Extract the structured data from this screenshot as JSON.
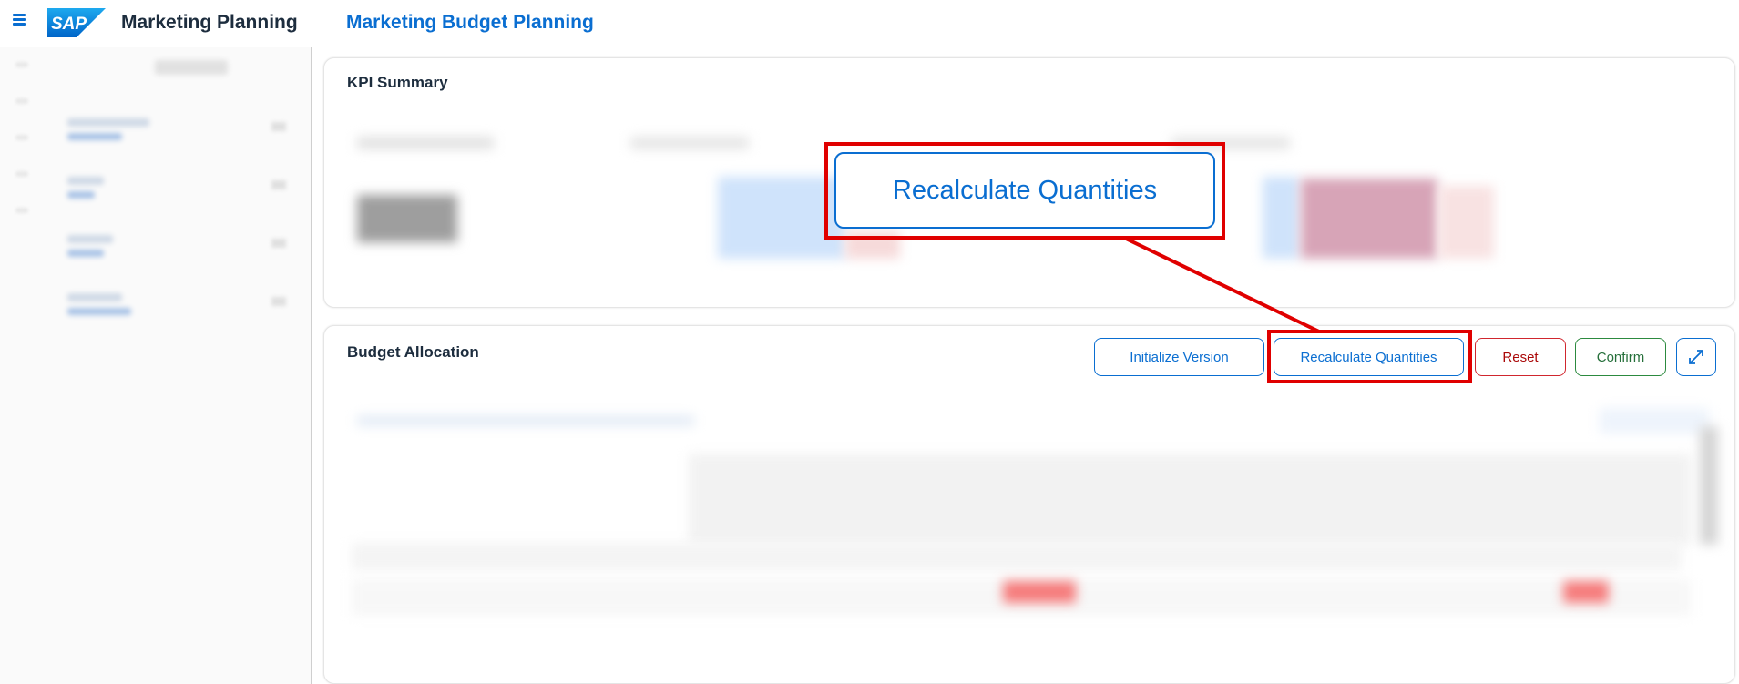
{
  "header": {
    "logo_text": "SAP",
    "app_title": "Marketing Planning",
    "page_title": "Marketing Budget Planning",
    "brand_color": "#0a6ed1"
  },
  "icons": {
    "menu": "hamburger-menu-icon",
    "expand": "fullscreen-expand-icon"
  },
  "kpi_summary": {
    "title": "KPI Summary"
  },
  "budget_allocation": {
    "title": "Budget Allocation",
    "buttons": {
      "initialize": "Initialize Version",
      "recalculate": "Recalculate Quantities",
      "reset": "Reset",
      "confirm": "Confirm"
    }
  },
  "callout": {
    "label": "Recalculate Quantities",
    "highlight_color": "#e00000"
  }
}
